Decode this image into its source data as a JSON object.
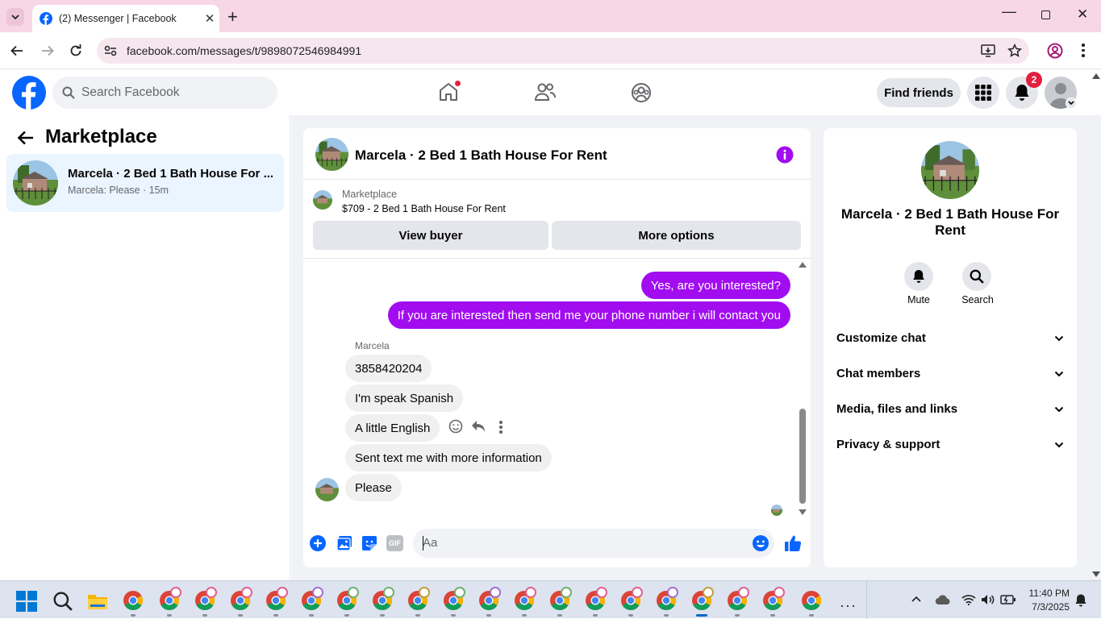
{
  "browser": {
    "tab_title": "(2) Messenger | Facebook",
    "url": "facebook.com/messages/t/9898072546984991"
  },
  "header": {
    "search_placeholder": "Search Facebook",
    "find_friends": "Find friends",
    "notification_count": "2"
  },
  "sidebar": {
    "title": "Marketplace",
    "conversation": {
      "name": "Marcela · 2 Bed 1 Bath House For ...",
      "preview": "Marcela: Please · 15m"
    }
  },
  "chat": {
    "title": "Marcela · 2 Bed 1 Bath House For Rent",
    "listing_source": "Marketplace",
    "listing_text": "$709 - 2 Bed 1 Bath House For Rent",
    "view_buyer": "View buyer",
    "more_options": "More options",
    "outgoing": [
      "Yes, are you interested?",
      "If you are interested then send me your phone number i will contact you"
    ],
    "sender_name": "Marcela",
    "incoming": [
      "3858420204",
      "I'm speak Spanish",
      "A little English",
      "Sent text me with more information",
      "Please"
    ],
    "composer_placeholder": "Aa",
    "gif_label": "GIF"
  },
  "details": {
    "name": "Marcela · 2 Bed 1 Bath House For Rent",
    "mute": "Mute",
    "search": "Search",
    "sections": [
      "Customize chat",
      "Chat members",
      "Media, files and links",
      "Privacy & support"
    ]
  },
  "taskbar": {
    "time": "11:40 PM",
    "date": "7/3/2025"
  },
  "colors": {
    "accent": "#a20df0",
    "facebook_blue": "#0866ff",
    "chrome_tab_bg": "#f7d7e6"
  }
}
